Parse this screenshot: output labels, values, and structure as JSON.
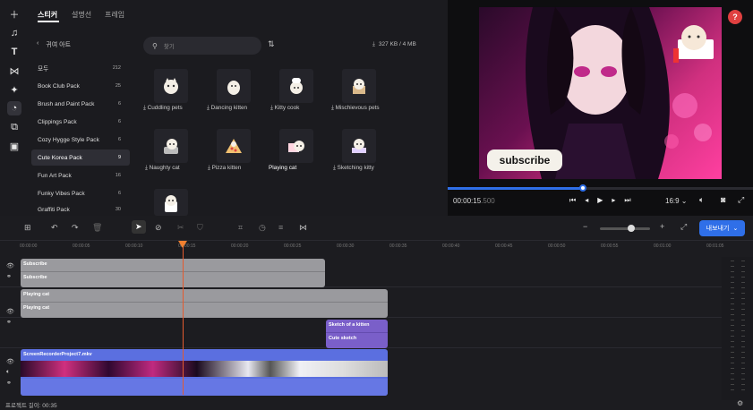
{
  "tabs": [
    "스티커",
    "설명선",
    "프레임"
  ],
  "back_label": "귀여 아트",
  "search_placeholder": "찾기",
  "storage": "327 KB / 4 MB",
  "categories": [
    {
      "label": "모두",
      "count": "212"
    },
    {
      "label": "Book Club Pack",
      "count": "25"
    },
    {
      "label": "Brush and Paint Pack",
      "count": "6"
    },
    {
      "label": "Clippings Pack",
      "count": "6"
    },
    {
      "label": "Cozy Hygge Style Pack",
      "count": "6"
    },
    {
      "label": "Cute Korea Pack",
      "count": "9"
    },
    {
      "label": "Fun Art Pack",
      "count": "16"
    },
    {
      "label": "Funky Vibes Pack",
      "count": "6"
    },
    {
      "label": "Graffiti Pack",
      "count": "30"
    }
  ],
  "stickers": [
    {
      "label": "Cuddling pets",
      "icon": "cat-pets-icon"
    },
    {
      "label": "Dancing kitten",
      "icon": "kitten-icon"
    },
    {
      "label": "Kitty cook",
      "icon": "cook-cat-icon"
    },
    {
      "label": "Mischievous pets",
      "icon": "box-cat-icon"
    },
    {
      "label": "Naughty cat",
      "icon": "naughty-cat-icon"
    },
    {
      "label": "Pizza kitten",
      "icon": "pizza-cat-icon"
    },
    {
      "label": "Playing cat",
      "icon": "playing-cat-icon"
    },
    {
      "label": "Sketching kitty",
      "icon": "sketch-cat-icon"
    },
    {
      "label": "",
      "icon": "cup-cat-icon"
    }
  ],
  "preview": {
    "subscribe_text": "subscribe",
    "time_current": "00:00:15",
    "time_ms": ".500",
    "aspect": "16:9",
    "help": "?"
  },
  "export_label": "내보내기",
  "ruler": [
    "00:00:00",
    "00:00:05",
    "00:00:10",
    "00:00:15",
    "00:00:20",
    "00:00:25",
    "00:00:30",
    "00:00:35",
    "00:00:40",
    "00:00:45",
    "00:00:50",
    "00:00:55",
    "00:01:00",
    "00:01:05"
  ],
  "tracks": {
    "t1_title": "Subscribe",
    "t1_sub": "Subscribe",
    "t2_title": "Playing cat",
    "t2_sub": "Playing cat",
    "t3_title": "Sketch of a kitten",
    "t3_sub": "Cute sketch",
    "video_name": "ScreenRecorderProject7.mkv"
  },
  "project_length": "프로젝트 길이: 00:35",
  "colors": {
    "accent": "#2f6fe8",
    "pink": "#d83a8f",
    "clip_gray": "#9a9a9e",
    "clip_purple": "#7a5fc9",
    "video_blue": "#5b6fe0"
  }
}
